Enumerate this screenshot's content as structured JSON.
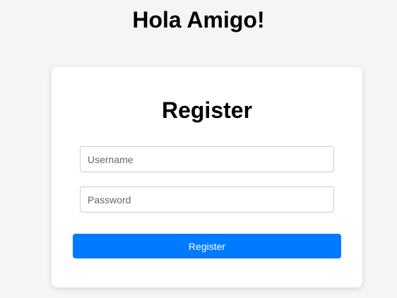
{
  "header": {
    "title": "Hola Amigo!"
  },
  "register_form": {
    "title": "Register",
    "username": {
      "value": "",
      "placeholder": "Username"
    },
    "password": {
      "value": "",
      "placeholder": "Password"
    },
    "submit_label": "Register"
  },
  "colors": {
    "background": "#f5f5f5",
    "card": "#ffffff",
    "accent": "#007bff",
    "button_text": "#ffffff",
    "input_border": "#cccccc"
  }
}
